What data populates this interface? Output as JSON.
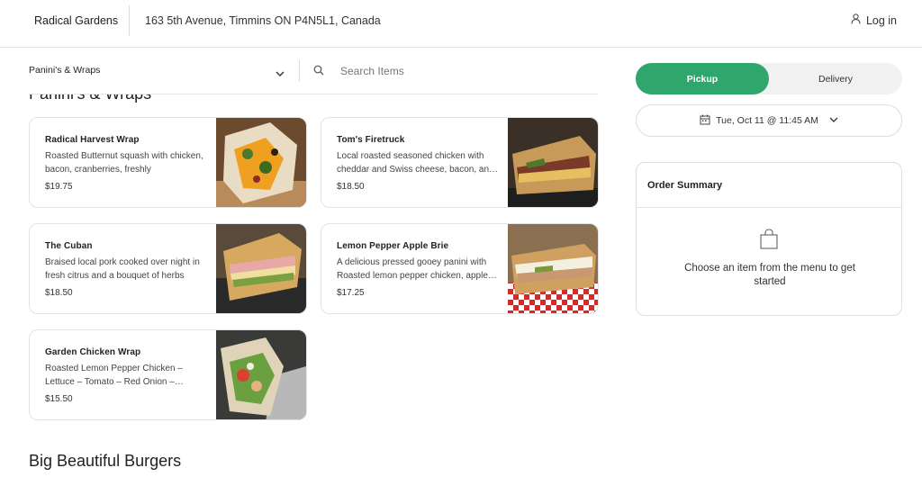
{
  "header": {
    "brand": "Radical Gardens",
    "address": "163 5th Avenue, Timmins ON P4N5L1, Canada",
    "login_label": "Log in"
  },
  "menu_bar": {
    "category": "Panini's & Wraps",
    "search_placeholder": "Search Items"
  },
  "sections": [
    {
      "title": "Panini's & Wraps",
      "items": [
        {
          "name": "Radical Harvest Wrap",
          "description": "Roasted Butternut squash with chicken, bacon, cranberries, freshly",
          "price": "$19.75"
        },
        {
          "name": "Tom's Firetruck",
          "description": "Local roasted seasoned chicken with cheddar and Swiss cheese, bacon, and more",
          "price": "$18.50"
        },
        {
          "name": "The Cuban",
          "description": "Braised local pork cooked over night in fresh citrus and a bouquet of herbs",
          "price": "$18.50"
        },
        {
          "name": "Lemon Pepper Apple Brie",
          "description": "A delicious pressed gooey panini with Roasted lemon pepper chicken, apple and brie",
          "price": "$17.25"
        },
        {
          "name": "Garden Chicken Wrap",
          "description": "Roasted Lemon Pepper Chicken – Lettuce – Tomato – Red Onion – Cheese",
          "price": "$15.50"
        }
      ]
    },
    {
      "title": "Big Beautiful Burgers"
    }
  ],
  "order": {
    "pickup_label": "Pickup",
    "delivery_label": "Delivery",
    "selected_mode": "Pickup",
    "datetime": "Tue, Oct 11 @ 11:45 AM",
    "summary_title": "Order Summary",
    "empty_message": "Choose an item from the menu to get started"
  },
  "colors": {
    "accent": "#2fa66b",
    "border": "#e3e3e3",
    "toggle_bg": "#f1f1f1"
  }
}
